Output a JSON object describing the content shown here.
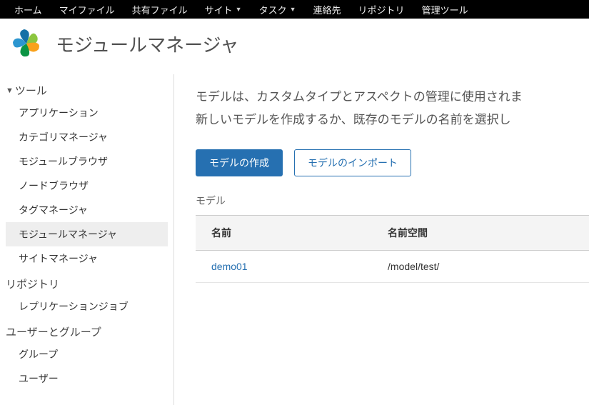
{
  "topnav": {
    "items": [
      {
        "label": "ホーム",
        "dropdown": false
      },
      {
        "label": "マイファイル",
        "dropdown": false
      },
      {
        "label": "共有ファイル",
        "dropdown": false
      },
      {
        "label": "サイト",
        "dropdown": true
      },
      {
        "label": "タスク",
        "dropdown": true
      },
      {
        "label": "連絡先",
        "dropdown": false
      },
      {
        "label": "リポジトリ",
        "dropdown": false
      },
      {
        "label": "管理ツール",
        "dropdown": false
      }
    ]
  },
  "header": {
    "title": "モジュールマネージャ"
  },
  "sidebar": {
    "sections": [
      {
        "title": "ツール",
        "items": [
          {
            "label": "アプリケーション",
            "active": false
          },
          {
            "label": "カテゴリマネージャ",
            "active": false
          },
          {
            "label": "モジュールブラウザ",
            "active": false
          },
          {
            "label": "ノードブラウザ",
            "active": false
          },
          {
            "label": "タグマネージャ",
            "active": false
          },
          {
            "label": "モジュールマネージャ",
            "active": true
          },
          {
            "label": "サイトマネージャ",
            "active": false
          }
        ]
      },
      {
        "title": "リポジトリ",
        "items": [
          {
            "label": "レプリケーションジョブ",
            "active": false
          }
        ]
      },
      {
        "title": "ユーザーとグループ",
        "items": [
          {
            "label": "グループ",
            "active": false
          },
          {
            "label": "ユーザー",
            "active": false
          }
        ]
      }
    ]
  },
  "main": {
    "description_line1": "モデルは、カスタムタイプとアスペクトの管理に使用されま",
    "description_line2": "新しいモデルを作成するか、既存のモデルの名前を選択し",
    "create_button": "モデルの作成",
    "import_button": "モデルのインポート",
    "table_label": "モデル",
    "columns": {
      "name": "名前",
      "namespace": "名前空間"
    },
    "rows": [
      {
        "name": "demo01",
        "namespace": "/model/test/"
      }
    ]
  },
  "colors": {
    "accent": "#2670b1",
    "text": "#333333",
    "muted": "#666666"
  }
}
